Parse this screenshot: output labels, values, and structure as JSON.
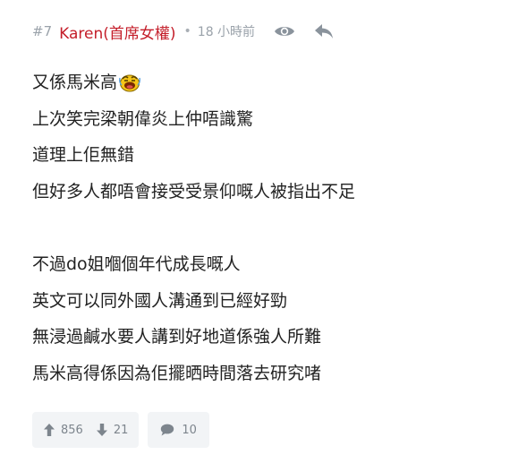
{
  "post": {
    "floor": "#7",
    "author": "Karen(首席女權)",
    "separator": "•",
    "time": "18 小時前",
    "icons": {
      "view": "eye-icon",
      "reply": "reply-arrow-icon",
      "emoji": "laughing-emoji-icon"
    },
    "lines": [
      "又係馬米高",
      "上次笑完梁朝偉炎上仲唔識驚",
      "道理上佢無錯",
      "但好多人都唔會接受受景仰嘅人被指出不足",
      "",
      "不過do姐嗰個年代成長嘅人",
      "英文可以同外國人溝通到已經好勁",
      "無浸過鹹水要人講到好地道係強人所難",
      "馬米高得係因為佢擺晒時間落去研究啫"
    ],
    "upvotes": "856",
    "downvotes": "21",
    "comments": "10",
    "colors": {
      "author": "#c41e2a",
      "meta": "#9aa2aa",
      "text": "#222222",
      "button_bg": "#f2f4f6"
    }
  }
}
